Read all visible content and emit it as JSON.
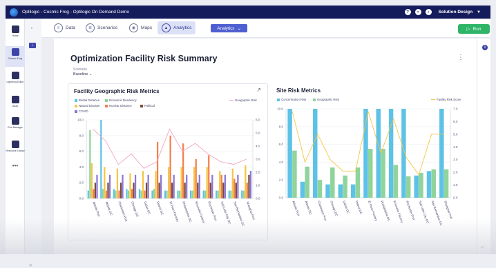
{
  "window": {
    "title": "Optilogic - Cosmic Frog - Optilogic On Demand Demo",
    "user": "Solution Design"
  },
  "nav": [
    {
      "label": "Home",
      "icon": "home-icon"
    },
    {
      "label": "Cosmic Frog",
      "icon": "frog-icon"
    },
    {
      "label": "Lightning Editor",
      "icon": "lightning-icon"
    },
    {
      "label": "Atlas",
      "icon": "rocket-icon"
    },
    {
      "label": "Run Manager",
      "icon": "bar-chart-icon"
    },
    {
      "label": "Resource Library",
      "icon": "library-icon"
    }
  ],
  "tabs": [
    {
      "label": "Data",
      "icon": "database-icon"
    },
    {
      "label": "Scenarios",
      "icon": "list-icon"
    },
    {
      "label": "Maps",
      "icon": "map-pin-icon"
    },
    {
      "label": "Analytics",
      "icon": "analytics-icon"
    }
  ],
  "toolbar": {
    "analytics_dropdown": "Analytics",
    "run_label": "Run"
  },
  "dashboard": {
    "title": "Optimization Facility Risk Summary",
    "scenario_label": "Scenario",
    "scenario_value": "Baseline"
  },
  "colors": {
    "brand": "#141c5c",
    "accent": "#4f5ed0",
    "run": "#2fb568",
    "c_blue": "#5ec2e6",
    "c_green": "#8fd49a",
    "c_yellow": "#f5c542",
    "c_orange": "#f2804b",
    "c_brown": "#7a4a3a",
    "c_purple": "#8b77d6",
    "c_pink": "#f0a6c0"
  },
  "chart_data": [
    {
      "type": "bar",
      "title": "Facility Geographic Risk Metrics",
      "categories": [
        "Atlanta Port",
        "Atlanta DC",
        "Charleston Port",
        "Chicago DC",
        "Dallas DC",
        "Detroit DC",
        "El Paso Factory",
        "Philadelphia DC",
        "Knoxville Factory",
        "Rochester Port",
        "Salt Lake City DC",
        "San Bernardino DC",
        "Shanghai Port"
      ],
      "ylim": [
        0,
        10
      ],
      "y2lim": [
        0,
        6
      ],
      "yticks": [
        "0.0",
        "2.0",
        "4.0",
        "6.0",
        "8.0",
        "10.0"
      ],
      "y2ticks": [
        "0.0",
        "1.0",
        "2.0",
        "3.0",
        "4.0",
        "5.0",
        "6.0"
      ],
      "legend": [
        "Birdait Distance",
        "Economic Resiliency",
        "Natural Disaster",
        "Nuclear Distance",
        "Political",
        "COVID",
        "Geographic Risk"
      ],
      "series": [
        {
          "name": "Birdait Distance",
          "color": "#5ec2e6",
          "values": [
            1.0,
            10.0,
            1.2,
            1.2,
            1.2,
            1.0,
            1.0,
            1.0,
            1.0,
            1.0,
            1.0,
            1.0,
            1.0
          ]
        },
        {
          "name": "Economic Resiliency",
          "color": "#8fd49a",
          "values": [
            8.7,
            1.2,
            1.0,
            1.0,
            1.0,
            1.2,
            1.0,
            1.0,
            1.0,
            1.0,
            1.0,
            1.0,
            1.0
          ]
        },
        {
          "name": "Natural Disaster",
          "color": "#f5c542",
          "values": [
            4.5,
            4.0,
            3.8,
            3.2,
            3.5,
            3.5,
            4.0,
            4.0,
            4.0,
            4.0,
            3.5,
            3.8,
            4.2
          ]
        },
        {
          "name": "Nuclear Distance",
          "color": "#f2804b",
          "values": [
            1.2,
            1.0,
            1.0,
            1.2,
            1.0,
            7.2,
            8.0,
            7.0,
            5.0,
            5.5,
            3.0,
            2.5,
            2.0
          ]
        },
        {
          "name": "Political",
          "color": "#7a4a3a",
          "values": [
            2.0,
            2.0,
            2.0,
            2.0,
            2.0,
            2.0,
            2.0,
            2.0,
            2.0,
            2.0,
            2.0,
            2.0,
            3.0
          ]
        },
        {
          "name": "COVID",
          "color": "#8b77d6",
          "values": [
            3.0,
            3.0,
            3.0,
            3.0,
            3.0,
            3.0,
            3.0,
            3.0,
            3.0,
            3.0,
            3.0,
            3.0,
            3.5
          ]
        }
      ],
      "line_series": {
        "name": "Geographic Risk",
        "color": "#f0a6c0",
        "values": [
          5.3,
          4.4,
          2.6,
          3.4,
          2.3,
          2.8,
          5.3,
          3.6,
          4.2,
          3.4,
          2.8,
          2.6,
          3.0
        ]
      }
    },
    {
      "type": "bar",
      "title": "Site Risk Metrics",
      "categories": [
        "Atlanta Port",
        "Atlanta DC",
        "Charleston Port",
        "Chicago DC",
        "Dallas DC",
        "Detroit DC",
        "El Paso Factory",
        "Philadelphia DC",
        "Knoxville Factory",
        "Rochester Port",
        "Salt Lake City DC",
        "San Bernardino DC",
        "Shanghai Port"
      ],
      "ylim": [
        0,
        10
      ],
      "y2lim": [
        0,
        7
      ],
      "yticks": [
        "0.0",
        "2.0",
        "4.0",
        "6.0",
        "8.0",
        "10.0"
      ],
      "y2ticks": [
        "0.0",
        "1.0",
        "2.0",
        "3.0",
        "4.0",
        "5.0",
        "6.0",
        "7.0"
      ],
      "legend": [
        "Concentration Risk",
        "Geographic Risk",
        "Facility Risk Score"
      ],
      "series": [
        {
          "name": "Concentration Risk",
          "color": "#5ec2e6",
          "values": [
            10.0,
            1.8,
            10.0,
            1.5,
            1.5,
            1.5,
            10.0,
            10.0,
            10.0,
            10.0,
            2.5,
            3.0,
            10.0
          ]
        },
        {
          "name": "Geographic Risk",
          "color": "#8fd49a",
          "values": [
            5.3,
            3.5,
            2.0,
            3.4,
            2.5,
            3.4,
            5.5,
            5.5,
            3.7,
            2.4,
            2.8,
            3.2,
            3.2
          ]
        }
      ],
      "line_series": {
        "name": "Facility Risk Score",
        "color": "#f5c542",
        "values": [
          6.8,
          2.8,
          5.0,
          3.0,
          2.1,
          2.1,
          6.8,
          3.5,
          6.2,
          3.2,
          1.8,
          5.0,
          5.0
        ]
      }
    }
  ]
}
